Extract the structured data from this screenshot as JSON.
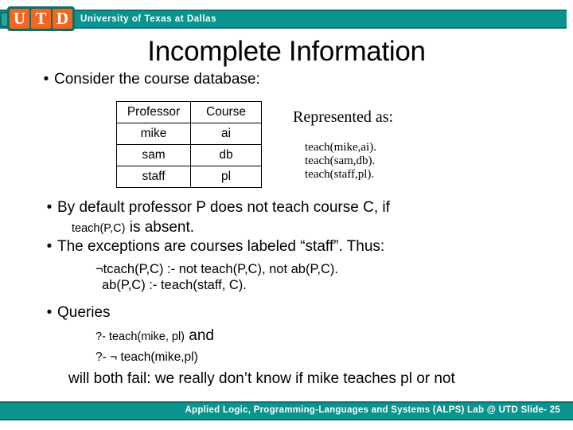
{
  "header": {
    "logo_letters": [
      "U",
      "T",
      "D"
    ],
    "university_name": "University of Texas at Dallas",
    "band_color": "#0a9490",
    "logo_color": "#f4651f"
  },
  "slide": {
    "title": "Incomplete Information"
  },
  "bullets": {
    "consider": "Consider the course database:",
    "default_main": "By default professor P does not teach course C, if",
    "default_cont_code": "teach(P,C)",
    "default_cont_rest": " is absent.",
    "exceptions": "The exceptions are courses labeled “staff”. Thus:",
    "queries": "Queries"
  },
  "table": {
    "headers": [
      "Professor",
      "Course"
    ],
    "rows": [
      [
        "mike",
        "ai"
      ],
      [
        "sam",
        "db"
      ],
      [
        "staff",
        "pl"
      ]
    ]
  },
  "represented": {
    "heading": "Represented as:",
    "facts": [
      "teach(mike,ai).",
      "teach(sam,db).",
      "teach(staff,pl)."
    ]
  },
  "rules": [
    "¬tcach(P,C) :- not teach(P,C), not ab(P,C).",
    "ab(P,C) :- teach(staff, C)."
  ],
  "queries": {
    "query_1_code": "?- teach(mike, pl)",
    "query_1_suffix": " and",
    "query_2": "?- ¬ teach(mike,pl)",
    "conclusion": "will both fail: we really don’t know if mike teaches pl or not"
  },
  "footer": {
    "text": "Applied Logic, Programming-Languages and Systems (ALPS) Lab @ UTD  Slide- 25"
  }
}
